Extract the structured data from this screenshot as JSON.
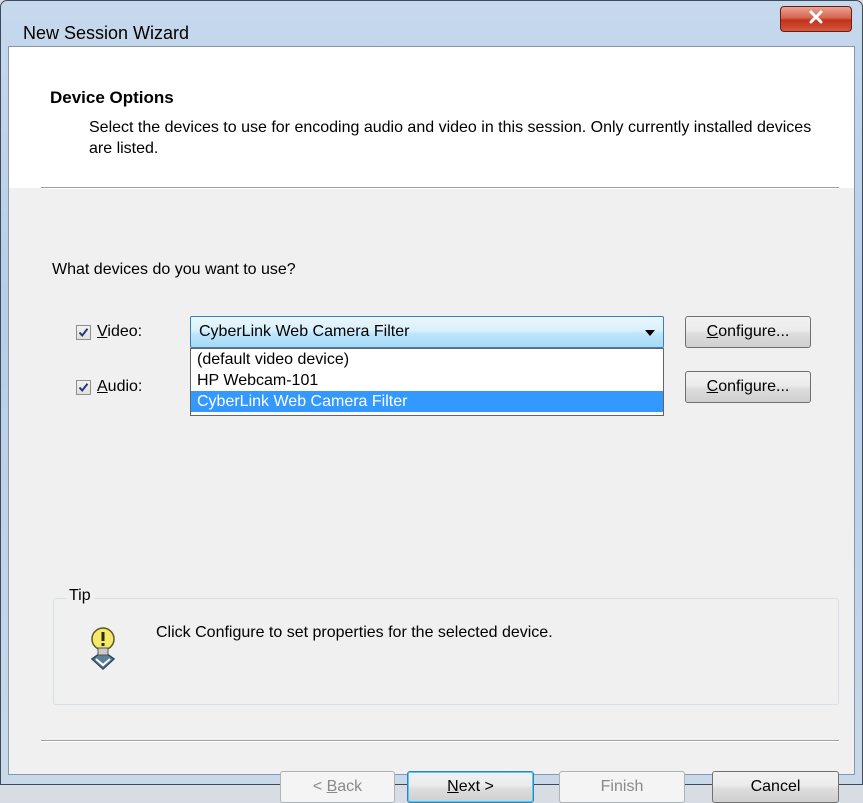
{
  "window": {
    "title": "New Session Wizard",
    "close_glyph": "x"
  },
  "header": {
    "title": "Device Options",
    "subtitle": "Select the devices to use for encoding audio and video in this session. Only currently installed devices are listed."
  },
  "body": {
    "question": "What devices do you want to use?",
    "video": {
      "checked": true,
      "label_accel": "V",
      "label_rest": "ideo:",
      "selected": "CyberLink Web Camera Filter",
      "options": [
        "(default video device)",
        "HP Webcam-101",
        "CyberLink Web Camera Filter"
      ],
      "configure_accel": "C",
      "configure_rest": "onfigure..."
    },
    "audio": {
      "checked": true,
      "label_accel": "A",
      "label_rest": "udio:",
      "configure_accel": "C",
      "configure_rest": "onfigure..."
    },
    "tip": {
      "legend": "Tip",
      "text": "Click Configure to set properties for the selected device.",
      "icon": "lightbulb-icon"
    }
  },
  "footer": {
    "back_prefix": "< ",
    "back_accel": "B",
    "back_rest": "ack",
    "next_accel": "N",
    "next_rest": "ext >",
    "finish": "Finish",
    "cancel": "Cancel"
  },
  "colors": {
    "selection": "#3399ff",
    "close_button": "#c1311b"
  }
}
